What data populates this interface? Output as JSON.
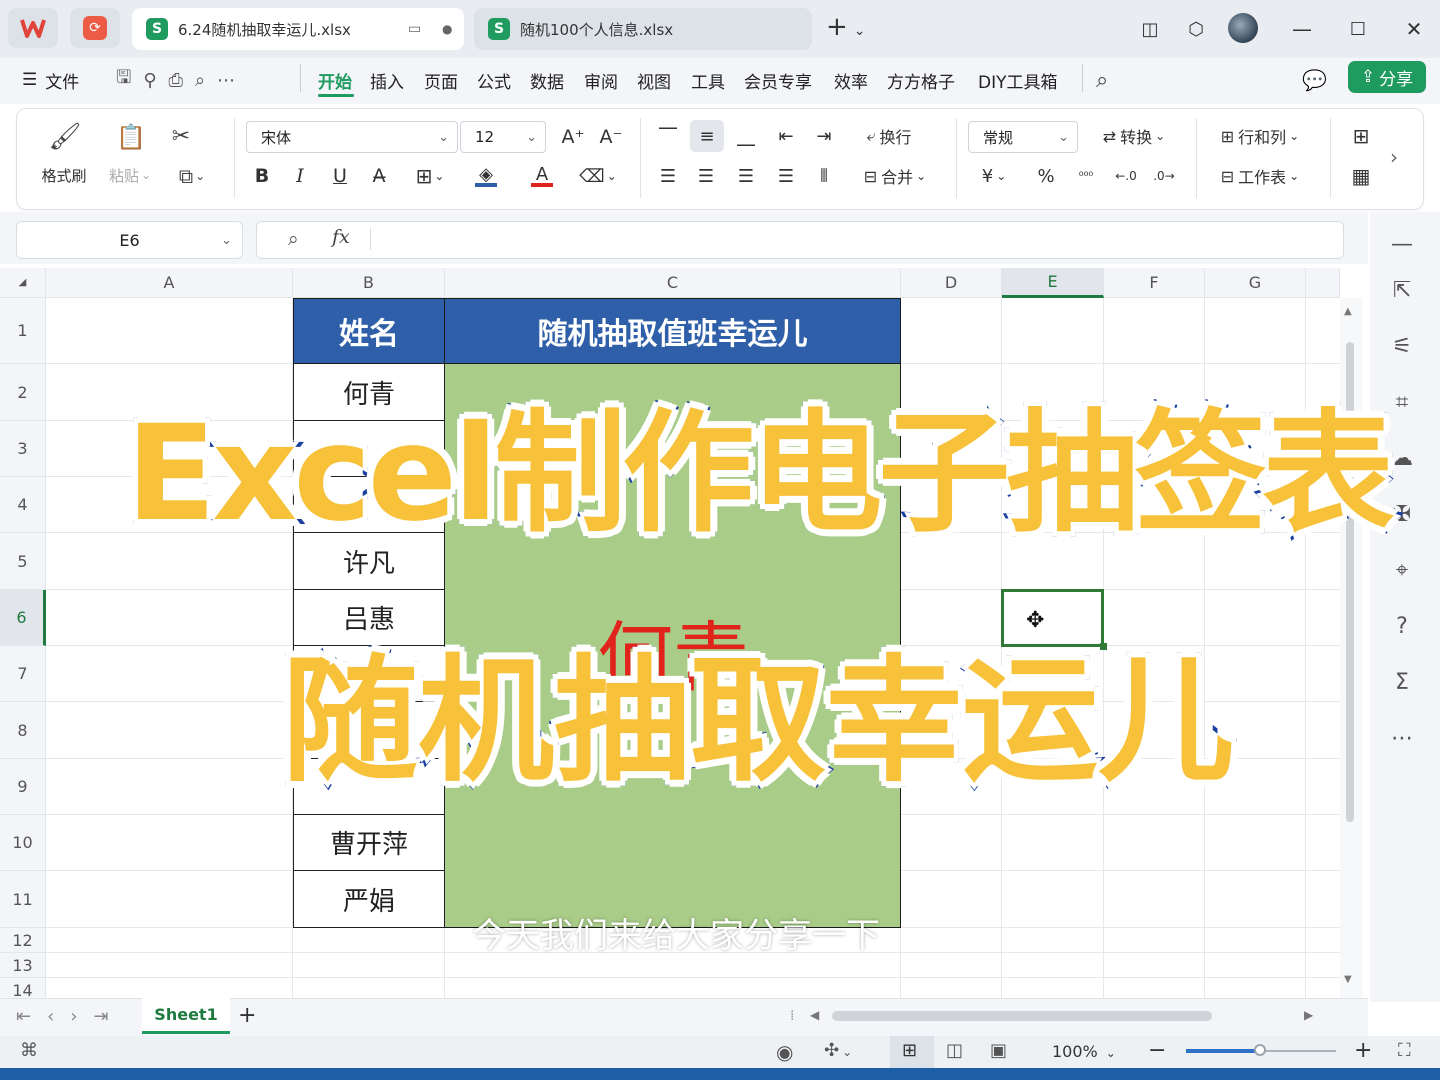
{
  "titlebar": {
    "tabs": [
      {
        "label": "6.24随机抽取幸运儿.xlsx",
        "active": true
      },
      {
        "label": "随机100个人信息.xlsx",
        "active": false
      }
    ],
    "new_tab_label": "+"
  },
  "menu": {
    "file": "文件",
    "items": [
      "开始",
      "插入",
      "页面",
      "公式",
      "数据",
      "审阅",
      "视图",
      "工具",
      "会员专享",
      "效率",
      "方方格子",
      "DIY工具箱"
    ],
    "active": "开始",
    "share": "分享"
  },
  "ribbon": {
    "format_painter": "格式刷",
    "paste": "粘贴",
    "font_name": "宋体",
    "font_size": "12",
    "wrap": "换行",
    "merge": "合并",
    "number_format": "常规",
    "convert": "转换",
    "rows_cols": "行和列",
    "worksheet": "工作表",
    "bold": "B",
    "italic": "I",
    "underline": "U",
    "currency": "¥",
    "percent": "%"
  },
  "formula_bar": {
    "name_box": "E6",
    "fx": "fx",
    "value": ""
  },
  "columns": [
    "A",
    "B",
    "C",
    "D",
    "E",
    "F",
    "G"
  ],
  "rows": [
    "1",
    "2",
    "3",
    "4",
    "5",
    "6",
    "7",
    "8",
    "9",
    "10",
    "11",
    "12",
    "13",
    "14"
  ],
  "sheet": {
    "header_name": "姓名",
    "header_title": "随机抽取值班幸运儿",
    "names": [
      {
        "row": "2",
        "text": "何青"
      },
      {
        "row": "5",
        "text": "许凡"
      },
      {
        "row": "6",
        "text": "吕惠"
      },
      {
        "row": "10",
        "text": "曹开萍"
      },
      {
        "row": "11",
        "text": "严娟"
      }
    ],
    "result": "何青"
  },
  "overlay": {
    "line1": "Excel制作电子抽签表",
    "line2": "随机抽取幸运儿",
    "subtitle": "今天我们来给大家分享一下"
  },
  "sheet_tabs": {
    "active": "Sheet1",
    "add": "+"
  },
  "status": {
    "zoom": "100%"
  },
  "colors": {
    "header_blue": "#2e5fa8",
    "result_green": "#a9cc89",
    "result_red": "#e0241b",
    "accent_green": "#1f9b5f",
    "overlay_yellow": "#f7c23a",
    "overlay_stroke": "#1b3fa0"
  }
}
